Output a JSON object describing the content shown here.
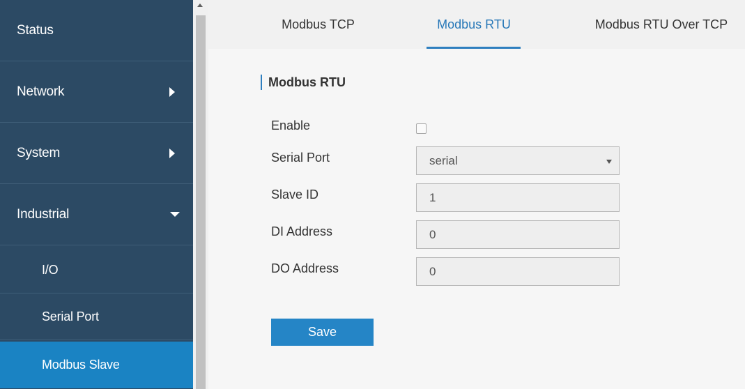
{
  "sidebar": {
    "items": [
      {
        "label": "Status",
        "has_arrow": "none"
      },
      {
        "label": "Network",
        "has_arrow": "right"
      },
      {
        "label": "System",
        "has_arrow": "right"
      },
      {
        "label": "Industrial",
        "has_arrow": "down"
      }
    ],
    "subitems": [
      {
        "label": "I/O"
      },
      {
        "label": "Serial Port"
      },
      {
        "label": "Modbus Slave",
        "active": true
      }
    ]
  },
  "tabs": [
    {
      "label": "Modbus TCP"
    },
    {
      "label": "Modbus RTU",
      "active": true
    },
    {
      "label": "Modbus RTU Over TCP"
    }
  ],
  "section": {
    "title": "Modbus RTU"
  },
  "form": {
    "enable_label": "Enable",
    "enable_checked": false,
    "serial_port_label": "Serial Port",
    "serial_port_value": "serial",
    "slave_id_label": "Slave ID",
    "slave_id_value": "1",
    "di_address_label": "DI Address",
    "di_address_value": "0",
    "do_address_label": "DO Address",
    "do_address_value": "0"
  },
  "actions": {
    "save_label": "Save"
  },
  "colors": {
    "sidebar_bg": "#2c4a64",
    "active_bg": "#1a83c3",
    "accent": "#2e7fbf"
  }
}
